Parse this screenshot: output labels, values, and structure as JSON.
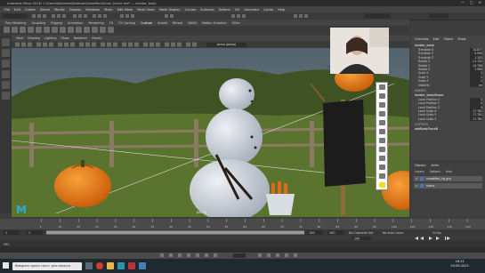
{
  "window": {
    "title": "Autodesk Maya 2016: C:\\Users\\Natasha\\Desktop\\SnowMan\\Snow_Scene.mb* --- locator_body",
    "min": "—",
    "max": "□",
    "close": "✕"
  },
  "menu": [
    "File",
    "Edit",
    "Create",
    "Select",
    "Modify",
    "Display",
    "Windows",
    "Mesh",
    "Edit Mesh",
    "Mesh Tools",
    "Mesh Display",
    "Curves",
    "Surfaces",
    "Deform",
    "UV",
    "Generate",
    "Cache",
    "Help"
  ],
  "shelf_tabs": [
    "Poly Modeling",
    "Sculpting",
    "Rigging",
    "Animation",
    "Rendering",
    "FX",
    "FX Caching",
    "Custom",
    "Arnold",
    "Bifrost",
    "MASH",
    "Motion Graphics",
    "XGen"
  ],
  "shelf_active": "Custom",
  "viewport": {
    "menu": [
      "View",
      "Shading",
      "Lighting",
      "Show",
      "Renderer",
      "Panels"
    ],
    "camera": "persp (persp)",
    "bottom_label": "persp"
  },
  "channel_box": {
    "tabs": [
      "Channels",
      "Edit",
      "Object",
      "Show"
    ],
    "object": "locator_body",
    "attributes": [
      {
        "name": "Translate X",
        "value": "14.877"
      },
      {
        "name": "Translate Y",
        "value": "5.594"
      },
      {
        "name": "Translate Z",
        "value": "1.103"
      },
      {
        "name": "Rotate X",
        "value": "-11.131"
      },
      {
        "name": "Rotate Y",
        "value": "14.798"
      },
      {
        "name": "Rotate Z",
        "value": "7.584"
      },
      {
        "name": "Scale X",
        "value": "1"
      },
      {
        "name": "Scale Y",
        "value": "1"
      },
      {
        "name": "Scale Z",
        "value": "1"
      },
      {
        "name": "Visibility",
        "value": "on"
      }
    ],
    "shapes_title": "SHAPES",
    "shape_name": "locator_bodyShape",
    "shape_attrs": [
      {
        "name": "Local Position X",
        "value": "0"
      },
      {
        "name": "Local Position Y",
        "value": "0"
      },
      {
        "name": "Local Position Z",
        "value": "0"
      },
      {
        "name": "Local Scale X",
        "value": "17.781"
      },
      {
        "name": "Local Scale Y",
        "value": "17.781"
      },
      {
        "name": "Local Scale Z",
        "value": "17.781"
      }
    ],
    "outputs_title": "OUTPUTS",
    "output_name": "addBodyTrackB"
  },
  "layer_editor": {
    "tabs": [
      "Display",
      "Anim"
    ],
    "menu": [
      "Layers",
      "Options",
      "Help"
    ],
    "layers": [
      {
        "vis": "V",
        "name": "snowMan_rig_grp"
      },
      {
        "vis": "V",
        "name": "scene"
      }
    ]
  },
  "timeline": {
    "start": "1",
    "end": "200",
    "current": "150",
    "range_start": "1",
    "range_end": "120",
    "ticks": [
      "5",
      "10",
      "15",
      "20",
      "25",
      "30",
      "35",
      "40",
      "45",
      "50",
      "55",
      "60",
      "65",
      "70",
      "75",
      "80",
      "85",
      "90",
      "95",
      "100",
      "105",
      "110",
      "115",
      "120"
    ],
    "character_set": "No Character Set",
    "anim_layer": "No Anim Layer",
    "fps": "24 fps"
  },
  "command_line": {
    "label": "MEL"
  },
  "taskbar": {
    "search_placeholder": "Введите здесь текст для поиска",
    "time": "16:21",
    "date": "29.09.2021"
  },
  "colors": {
    "sky": "#5b6b75",
    "grass": "#506b2f",
    "pumpkin": "#e87814",
    "snowman": "#cfd4dc",
    "scarecrow_body": "#1c1c1c",
    "hat": "#4b46a8"
  }
}
